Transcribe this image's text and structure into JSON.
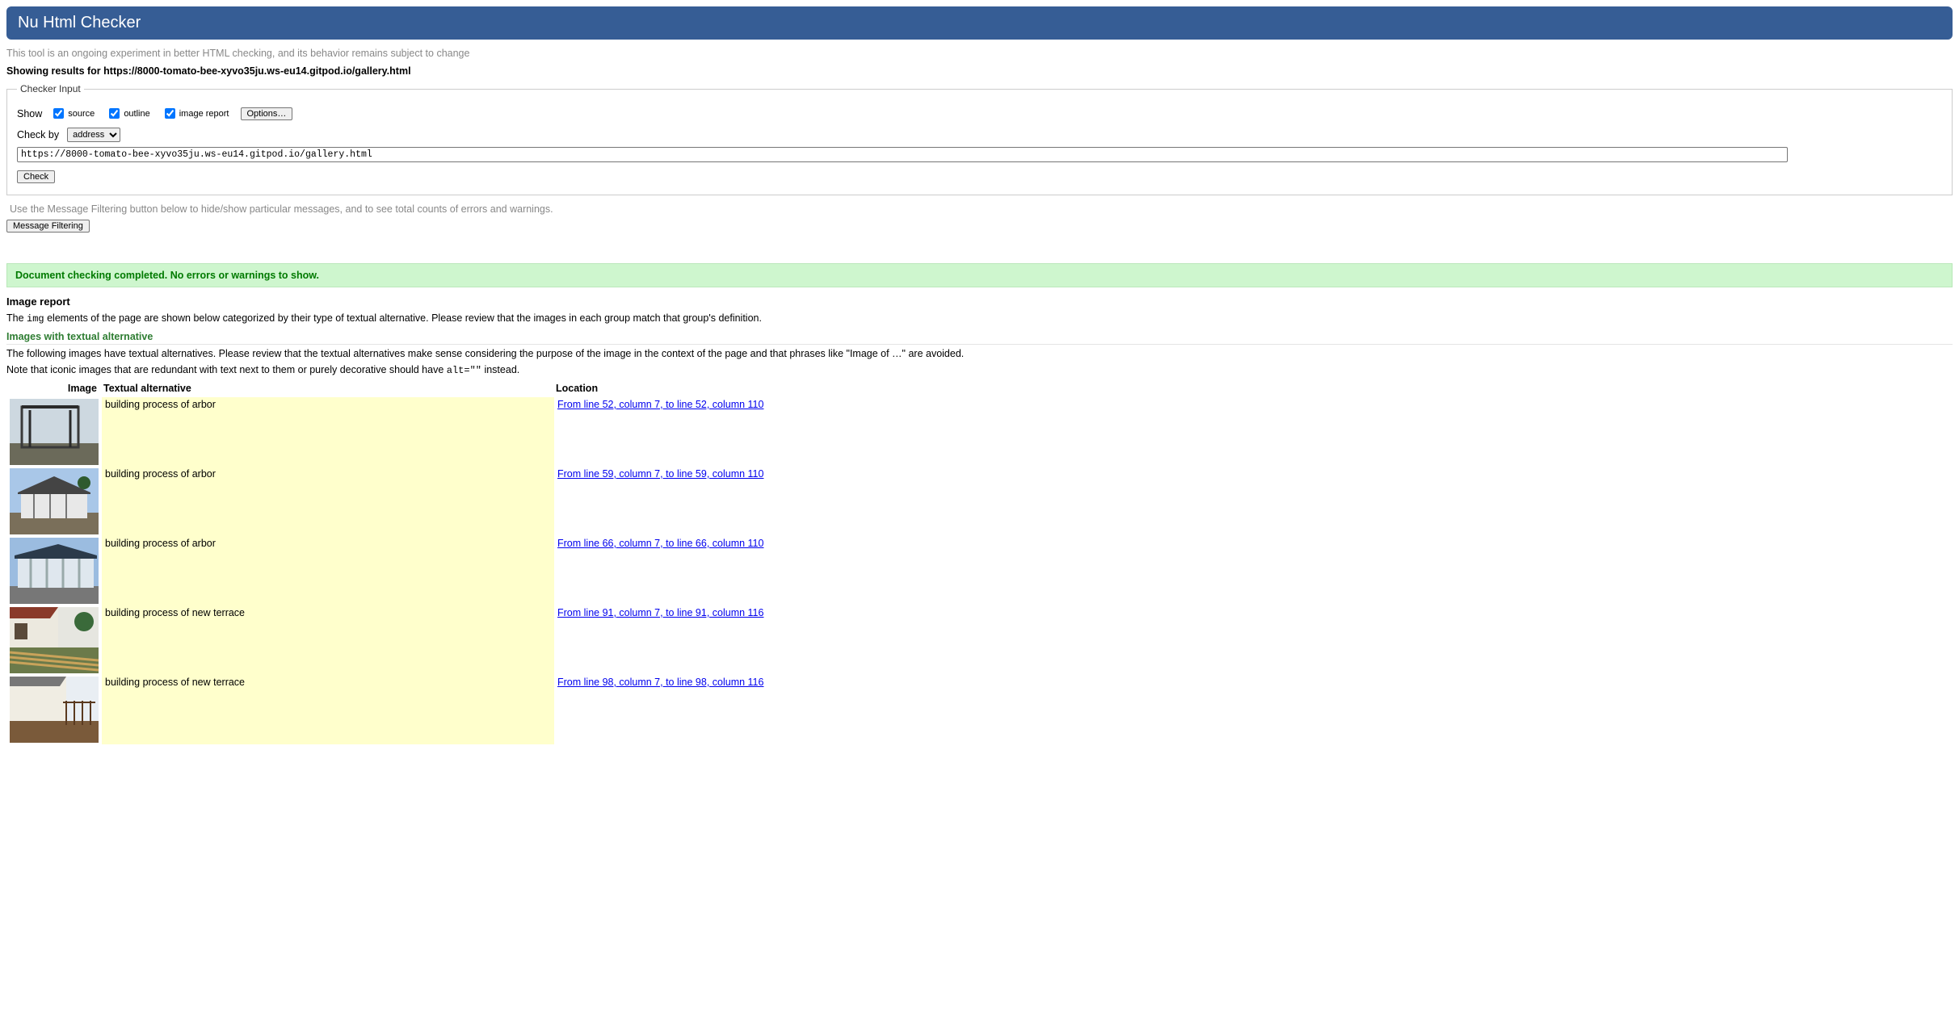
{
  "header": {
    "title": "Nu Html Checker"
  },
  "tagline": "This tool is an ongoing experiment in better HTML checking, and its behavior remains subject to change",
  "results_for": "Showing results for https://8000-tomato-bee-xyvo35ju.ws-eu14.gitpod.io/gallery.html",
  "fieldset": {
    "legend": "Checker Input",
    "show_label": "Show",
    "cb_source": "source",
    "cb_outline": "outline",
    "cb_imgreport": "image report",
    "options_btn": "Options…",
    "checkby_label": "Check by",
    "checkby_selected": "address",
    "address_value": "https://8000-tomato-bee-xyvo35ju.ws-eu14.gitpod.io/gallery.html",
    "check_btn": "Check"
  },
  "filter_hint": "Use the Message Filtering button below to hide/show particular messages, and to see total counts of errors and warnings.",
  "msg_filtering_btn": "Message Filtering",
  "success_text": "Document checking completed. No errors or warnings to show.",
  "image_report": {
    "heading": "Image report",
    "intro_pre": "The ",
    "intro_code": "img",
    "intro_post": " elements of the page are shown below categorized by their type of textual alternative. Please review that the images in each group match that group's definition.",
    "sub_heading": "Images with textual alternative",
    "sub_intro": "The following images have textual alternatives. Please review that the textual alternatives make sense considering the purpose of the image in the context of the page and that phrases like \"Image of …\" are avoided.",
    "note_pre": "Note that iconic images that are redundant with text next to them or purely decorative should have ",
    "note_code": "alt=\"\"",
    "note_post": " instead.",
    "th_image": "Image",
    "th_alt": "Textual alternative",
    "th_loc": "Location",
    "rows": [
      {
        "alt": "building process of arbor",
        "loc": "From line 52, column 7, to line 52, column 110"
      },
      {
        "alt": "building process of arbor",
        "loc": "From line 59, column 7, to line 59, column 110"
      },
      {
        "alt": "building process of arbor",
        "loc": "From line 66, column 7, to line 66, column 110"
      },
      {
        "alt": "building process of new terrace",
        "loc": "From line 91, column 7, to line 91, column 116"
      },
      {
        "alt": "building process of new terrace",
        "loc": "From line 98, column 7, to line 98, column 116"
      }
    ]
  }
}
